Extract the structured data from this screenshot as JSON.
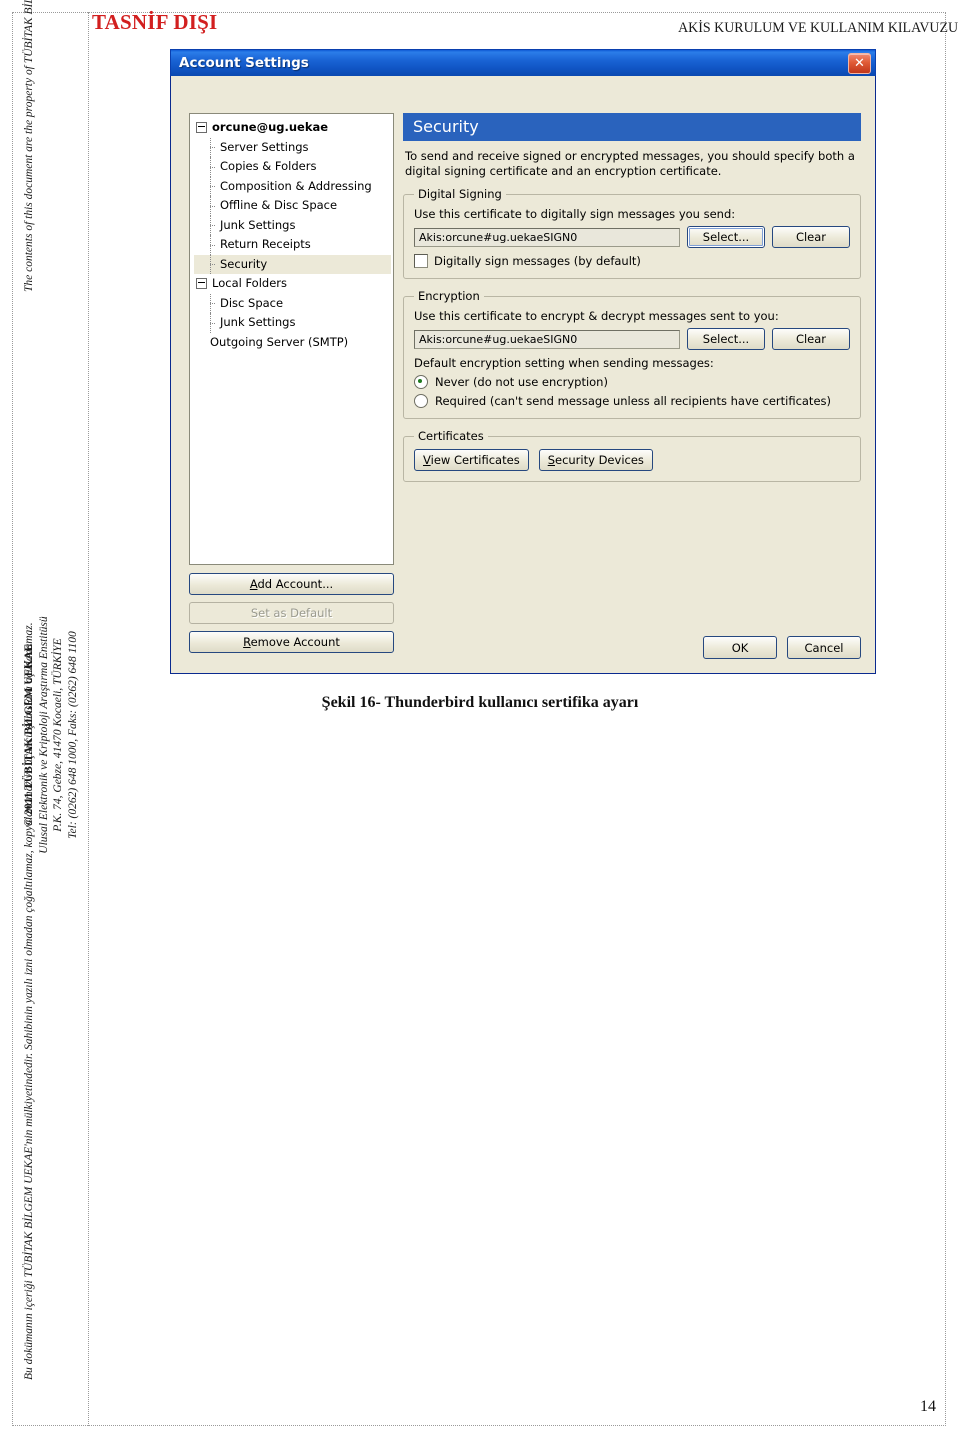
{
  "header": {
    "left_classification": "TASNİF DIŞI",
    "right_title": "AKİS KURULUM VE KULLANIM KILAVUZU"
  },
  "sidebar": {
    "english_notice": "The contents of this document are the property of TÜBİTAK BİLGEM UEKAE and should not be reproduced, copied or disclosed to a third party without the written consent of the proprietor.",
    "copyright_line": "© 2011 TÜBİTAK BİLGEM UEKAE",
    "institute_line": "Ulusal Elektronik ve Kriptoloji Araştırma Enstitüsü",
    "address_line": "P.K. 74, Gebze, 41470 Kocaeli, TÜRKİYE",
    "phone_line": "Tel: (0262) 648 1000, Faks: (0262) 648 1100",
    "turkish_notice": "Bu dokümanın içeriği TÜBİTAK BİLGEM UEKAE'nin mülkiyetindedir. Sahibinin yazılı izni olmadan çoğaltılamaz, kopyalanamaz ve üçüncü şahıslara açıklanamaz."
  },
  "dialog": {
    "title": "Account Settings",
    "close_icon": "close-icon",
    "tree": [
      {
        "label": "orcune@ug.uekae",
        "level": 0,
        "expander": true,
        "bold": true,
        "selected": false
      },
      {
        "label": "Server Settings",
        "level": 1,
        "expander": false,
        "bold": false,
        "selected": false
      },
      {
        "label": "Copies & Folders",
        "level": 1,
        "expander": false,
        "bold": false,
        "selected": false
      },
      {
        "label": "Composition & Addressing",
        "level": 1,
        "expander": false,
        "bold": false,
        "selected": false
      },
      {
        "label": "Offline & Disc Space",
        "level": 1,
        "expander": false,
        "bold": false,
        "selected": false
      },
      {
        "label": "Junk Settings",
        "level": 1,
        "expander": false,
        "bold": false,
        "selected": false
      },
      {
        "label": "Return Receipts",
        "level": 1,
        "expander": false,
        "bold": false,
        "selected": false
      },
      {
        "label": "Security",
        "level": 1,
        "expander": false,
        "bold": false,
        "selected": true
      },
      {
        "label": "Local Folders",
        "level": 0,
        "expander": true,
        "bold": false,
        "selected": false
      },
      {
        "label": "Disc Space",
        "level": 1,
        "expander": false,
        "bold": false,
        "selected": false
      },
      {
        "label": "Junk Settings",
        "level": 1,
        "expander": false,
        "bold": false,
        "selected": false
      },
      {
        "label": "Outgoing Server (SMTP)",
        "level": 0,
        "expander": false,
        "bold": false,
        "selected": false
      }
    ],
    "side_buttons": {
      "add_account": "Add Account...",
      "set_as_default": "Set as Default",
      "remove_account": "Remove Account"
    },
    "panel": {
      "heading": "Security",
      "intro": "To send and receive signed or encrypted messages, you should specify both a digital signing certificate and an encryption certificate.",
      "digital_signing": {
        "legend": "Digital Signing",
        "label": "Use this certificate to digitally sign messages you send:",
        "cert_value": "Akis:orcune#ug.uekaeSIGN0",
        "select_button": "Select...",
        "clear_button": "Clear",
        "checkbox_label": "Digitally sign messages (by default)",
        "checkbox_checked": false
      },
      "encryption": {
        "legend": "Encryption",
        "label": "Use this certificate to encrypt & decrypt messages sent to you:",
        "cert_value": "Akis:orcune#ug.uekaeSIGN0",
        "select_button": "Select...",
        "clear_button": "Clear",
        "default_label": "Default encryption setting when sending messages:",
        "option_never": "Never (do not use encryption)",
        "option_required": "Required (can't send message unless all recipients have certificates)",
        "selected_option": "never"
      },
      "certificates": {
        "legend": "Certificates",
        "view_button": "View Certificates",
        "devices_button": "Security Devices"
      }
    },
    "footer": {
      "ok": "OK",
      "cancel": "Cancel"
    }
  },
  "figure": {
    "caption": "Şekil 16- Thunderbird kullanıcı sertifika ayarı"
  },
  "page": {
    "number": "14"
  },
  "colors": {
    "classification_red": "#d21f1f",
    "titlebar_blue": "#1963d4",
    "section_bar_blue": "#2a63bd",
    "dialog_face": "#ece9d8",
    "close_red": "#e05b36"
  }
}
